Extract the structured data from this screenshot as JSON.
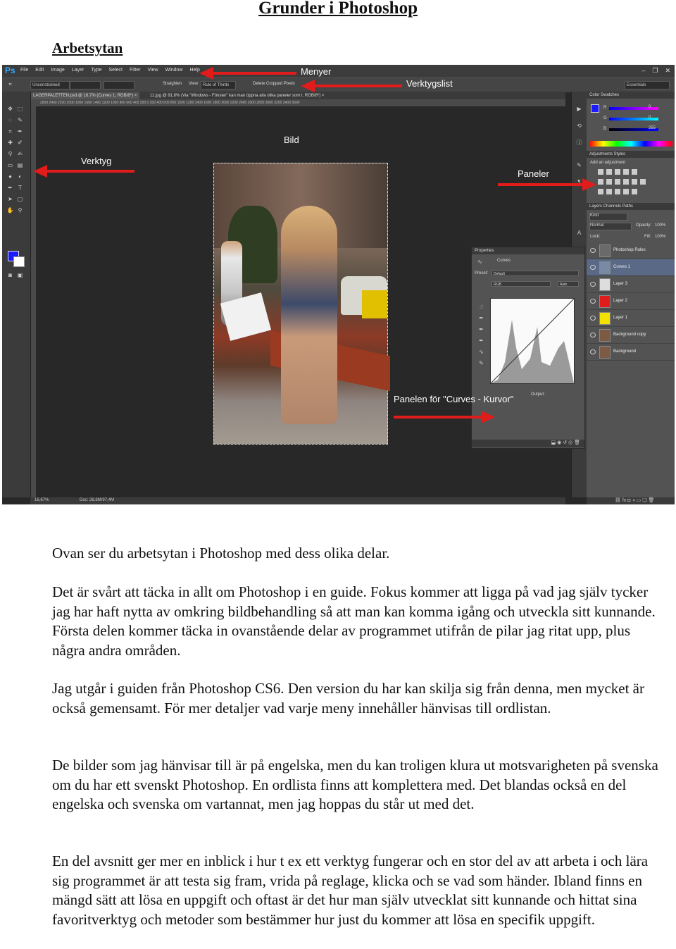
{
  "doc": {
    "title": "Grunder i Photoshop",
    "subtitle": "Arbetsytan"
  },
  "screenshot": {
    "app_logo": "Ps",
    "menus": [
      "File",
      "Edit",
      "Image",
      "Layer",
      "Type",
      "Select",
      "Filter",
      "View",
      "Window",
      "Help"
    ],
    "window_controls": [
      "–",
      "❐",
      "✕"
    ],
    "options_bar": {
      "ratio": "Unconstrained",
      "straighten": "Straighten",
      "view_label": "View:",
      "view_value": "Rule of Thirds",
      "delete_cropped": "Delete Cropped Pixels",
      "workspace": "Essentials"
    },
    "tabs": [
      "LAGERPALETTEN.psd @ 16,7% (Curves 1, RGB/8*) ×",
      "11.jpg @ 91,8% (Via \"Windows - Fönster\" kan man öppna alla olika paneler som t. RGB/8*) ×"
    ],
    "ruler_ticks": "2600  2400  2200  2000  1800  1600  1400  1200  1000  800  600  400  200  0  200  400  600  800  1000  1200  1400  1600  1800  2000  2200  2400  2600  2800  3000  3200  3400  3600",
    "status": {
      "zoom": "16,67%",
      "doc": "Doc: 28,8M/97,4M"
    },
    "color_panel": {
      "tabs": "Color   Swatches",
      "r": "R",
      "g": "G",
      "b": "B",
      "r_val": "0",
      "g_val": "0",
      "b_val": "255"
    },
    "adjustments_panel": {
      "tabs": "Adjustments   Styles",
      "hint": "Add an adjustment"
    },
    "layers_panel": {
      "tabs": "Layers   Channels   Paths",
      "kind": "Kind",
      "blend": "Normal",
      "opacity_label": "Opacity:",
      "opacity": "100%",
      "lock_label": "Lock:",
      "fill_label": "Fill:",
      "fill": "100%",
      "layers": [
        {
          "name": "Photoshop",
          "extra": "Rules",
          "thumb": "#6a6a6a",
          "selected": false
        },
        {
          "name": "Curves 1",
          "extra": "",
          "thumb": "#7a8aa6",
          "selected": true
        },
        {
          "name": "Layer 3",
          "extra": "",
          "thumb": "#dddddd",
          "selected": false
        },
        {
          "name": "Layer 2",
          "extra": "",
          "thumb": "#e01c1c",
          "selected": false
        },
        {
          "name": "Layer 1",
          "extra": "",
          "thumb": "#f2e000",
          "selected": false
        },
        {
          "name": "Background copy",
          "extra": "",
          "thumb": "#7c5a44",
          "selected": false
        },
        {
          "name": "Background",
          "extra": "",
          "thumb": "#7c5a44",
          "selected": false
        }
      ]
    },
    "properties_panel": {
      "title": "Properties",
      "type": "Curves",
      "preset_label": "Preset:",
      "preset_value": "Default",
      "channel": "RGB",
      "auto": "Auto",
      "output": "Output:"
    },
    "colors": {
      "fg": "#1a1aff",
      "bg": "#ffffff",
      "arrow": "#e21b1b",
      "ps_blue": "#31a8ff"
    }
  },
  "annotations": {
    "menyer": "Menyer",
    "verktygslist": "Verktygslist",
    "verktyg": "Verktyg",
    "bild": "Bild",
    "paneler": "Paneler",
    "curves": "Panelen för  \"Curves - Kurvor\""
  },
  "body": {
    "p1": "Ovan ser du arbetsytan i Photoshop med dess olika delar.",
    "p2": "Det är svårt att täcka in allt om Photoshop i en guide. Fokus kommer att ligga på vad jag själv tycker jag har haft nytta av omkring bildbehandling så att man kan komma igång och utveckla sitt kunnande. Första delen kommer täcka in ovanstående delar av programmet utifrån de pilar jag ritat upp, plus några andra områden.",
    "p3": "Jag utgår i guiden från Photoshop CS6. Den version du har kan skilja sig från denna, men mycket är också gemensamt. För mer detaljer vad varje meny innehåller hänvisas till ordlistan.",
    "p4": "De bilder som jag hänvisar till är på engelska, men du kan troligen klura ut motsvarigheten på svenska om du har ett svenskt Photoshop. En ordlista finns att komplettera med. Det blandas också en del engelska och svenska om vartannat, men jag hoppas du står ut med det.",
    "p5": "En del avsnitt ger mer en inblick i hur t ex ett verktyg fungerar och en stor del av att arbeta i och lära sig programmet är att testa sig fram, vrida på reglage, klicka och se vad som händer. Ibland finns en mängd sätt att lösa en uppgift och oftast är det hur man själv utvecklat sitt kunnande och hittat sina favoritverktyg och metoder som bestämmer hur just du kommer att lösa en specifik uppgift."
  }
}
